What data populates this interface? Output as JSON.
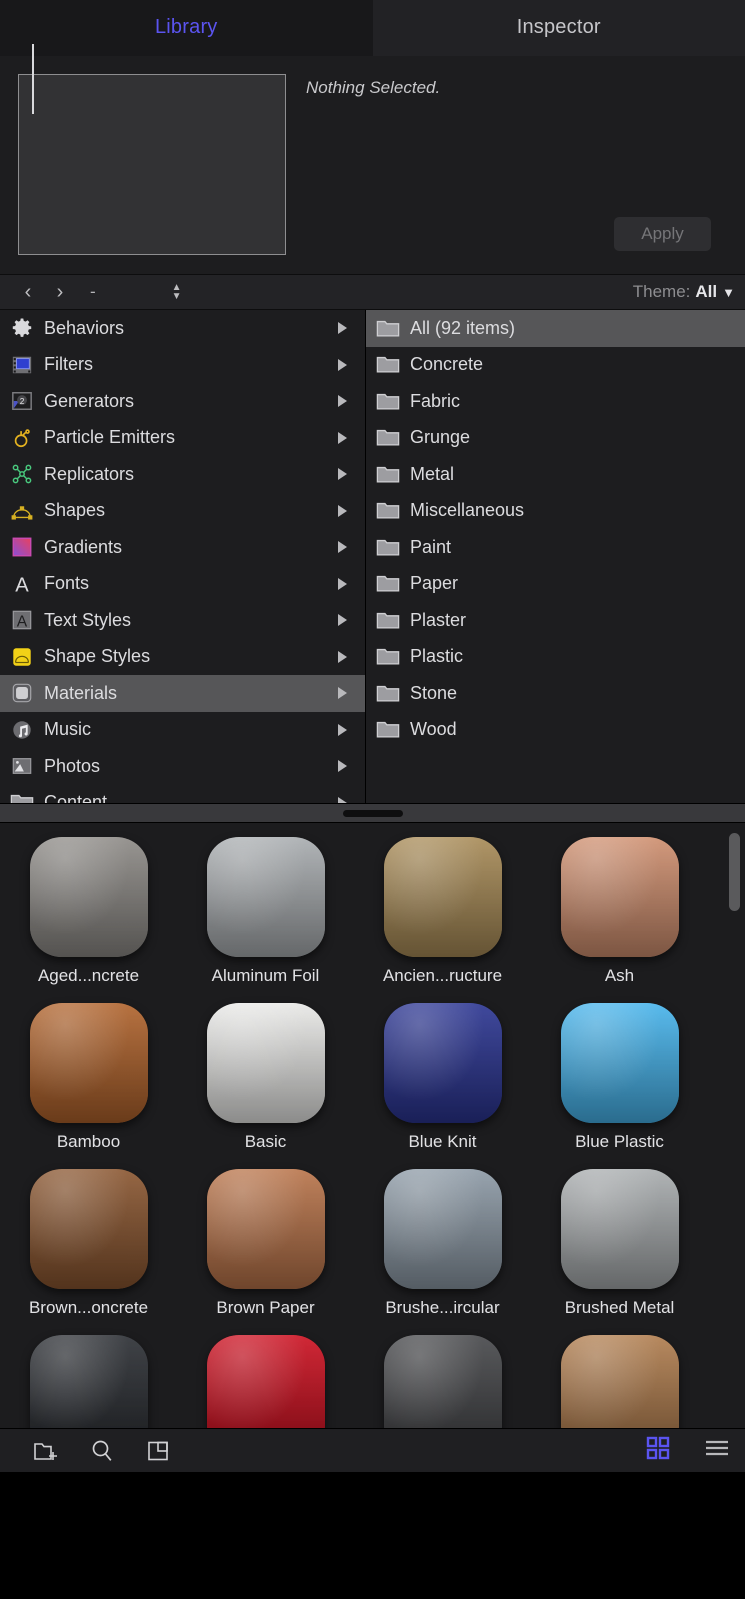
{
  "tabs": [
    {
      "label": "Library",
      "active": true
    },
    {
      "label": "Inspector",
      "active": false
    }
  ],
  "inspector": {
    "status_text": "Nothing Selected.",
    "apply_label": "Apply"
  },
  "navbar": {
    "back_icon": "chevron-left-icon",
    "forward_icon": "chevron-right-icon",
    "path_text": "-",
    "stepper_icon": "stepper-up-down-icon",
    "theme_label": "Theme:",
    "theme_value": "All",
    "theme_chevron": "chevron-down-icon"
  },
  "sidebar": {
    "items": [
      {
        "label": "Behaviors",
        "icon": "gear-icon",
        "selected": false
      },
      {
        "label": "Filters",
        "icon": "filmstrip-icon",
        "selected": false
      },
      {
        "label": "Generators",
        "icon": "generator-icon",
        "selected": false
      },
      {
        "label": "Particle Emitters",
        "icon": "particle-emitter-icon",
        "selected": false
      },
      {
        "label": "Replicators",
        "icon": "replicator-icon",
        "selected": false
      },
      {
        "label": "Shapes",
        "icon": "shape-icon",
        "selected": false
      },
      {
        "label": "Gradients",
        "icon": "gradient-icon",
        "selected": false
      },
      {
        "label": "Fonts",
        "icon": "font-a-icon",
        "selected": false
      },
      {
        "label": "Text Styles",
        "icon": "text-style-icon",
        "selected": false
      },
      {
        "label": "Shape Styles",
        "icon": "shape-style-icon",
        "selected": false
      },
      {
        "label": "Materials",
        "icon": "material-icon",
        "selected": true
      },
      {
        "label": "Music",
        "icon": "music-note-icon",
        "selected": false
      },
      {
        "label": "Photos",
        "icon": "photo-icon",
        "selected": false
      },
      {
        "label": "Content",
        "icon": "folder-icon",
        "selected": false
      }
    ]
  },
  "categories": {
    "items": [
      {
        "label": "All (92 items)",
        "selected": true
      },
      {
        "label": "Concrete",
        "selected": false
      },
      {
        "label": "Fabric",
        "selected": false
      },
      {
        "label": "Grunge",
        "selected": false
      },
      {
        "label": "Metal",
        "selected": false
      },
      {
        "label": "Miscellaneous",
        "selected": false
      },
      {
        "label": "Paint",
        "selected": false
      },
      {
        "label": "Paper",
        "selected": false
      },
      {
        "label": "Plaster",
        "selected": false
      },
      {
        "label": "Plastic",
        "selected": false
      },
      {
        "label": "Stone",
        "selected": false
      },
      {
        "label": "Wood",
        "selected": false
      }
    ]
  },
  "materials": {
    "items": [
      {
        "label": "Aged...ncrete",
        "color": "#8d8a86"
      },
      {
        "label": "Aluminum Foil",
        "color": "#a9adb0"
      },
      {
        "label": "Ancien...ructure",
        "color": "#a88b57"
      },
      {
        "label": "Ash",
        "color": "#cf8f6f"
      },
      {
        "label": "Bamboo",
        "color": "#b0632c"
      },
      {
        "label": "Basic",
        "color": "#e9e9e7"
      },
      {
        "label": "Blue Knit",
        "color": "#2b3592"
      },
      {
        "label": "Blue Plastic",
        "color": "#47b4ec"
      },
      {
        "label": "Brown...oncrete",
        "color": "#8a5630"
      },
      {
        "label": "Brown Paper",
        "color": "#b9744a"
      },
      {
        "label": "Brushe...ircular",
        "color": "#8d9aa6"
      },
      {
        "label": "Brushed Metal",
        "color": "#a8acae"
      },
      {
        "label": "",
        "color": "#2b2e33"
      },
      {
        "label": "",
        "color": "#cc1020"
      },
      {
        "label": "",
        "color": "#46474a"
      },
      {
        "label": "",
        "color": "#b07d4e"
      }
    ]
  },
  "toolbar": {
    "new_folder_icon": "new-folder-icon",
    "search_icon": "search-icon",
    "preview_icon": "preview-pane-icon",
    "grid_view_icon": "grid-view-icon",
    "list_view_icon": "list-view-icon",
    "active_view": "grid",
    "accent_color": "#5b54f0"
  }
}
